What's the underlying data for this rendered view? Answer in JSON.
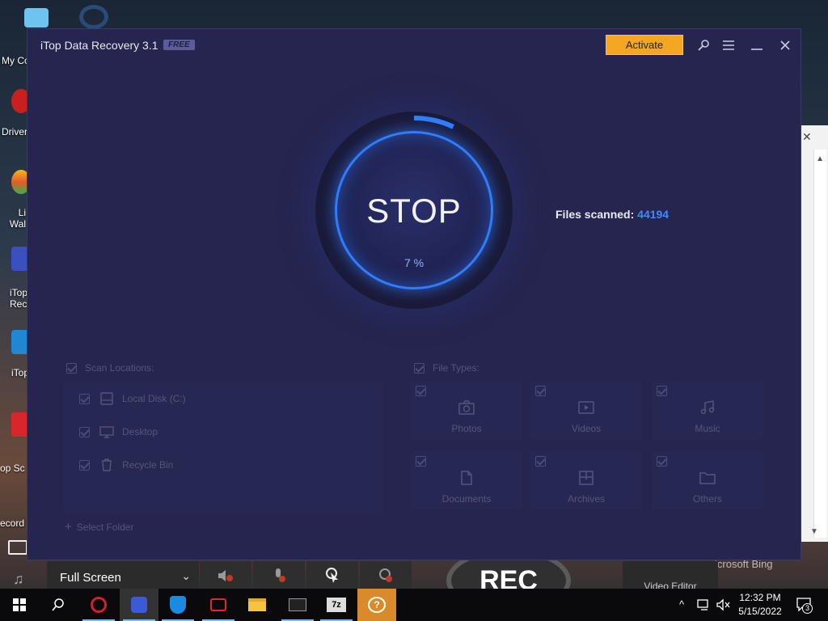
{
  "desktop": {
    "icons": [
      {
        "label": "My Co"
      },
      {
        "label": "Driver"
      },
      {
        "label": "Li\nWal"
      },
      {
        "label": "iTop\nRecord"
      },
      {
        "label": "iTop"
      },
      {
        "label": "op Sc"
      }
    ],
    "right_window_title": "icrosoft Bing"
  },
  "recorder": {
    "left_label": "ecord",
    "mode_label": "Full Screen",
    "rec_label": "REC",
    "video_editor_label": "Video Editor"
  },
  "app": {
    "title": "iTop Data Recovery 3.1",
    "badge": "FREE",
    "activate_label": "Activate",
    "scan": {
      "button_label": "STOP",
      "progress_text": "7 %",
      "progress": 0.07,
      "files_scanned_label": "Files scanned:",
      "files_scanned_count": "44194"
    },
    "locations": {
      "header": "Scan Locations:",
      "items": [
        {
          "label": "Local Disk (C:)"
        },
        {
          "label": "Desktop"
        },
        {
          "label": "Recycle Bin"
        }
      ],
      "select_folder": "Select Folder"
    },
    "file_types": {
      "header": "File Types:",
      "items": [
        {
          "label": "Photos"
        },
        {
          "label": "Videos"
        },
        {
          "label": "Music"
        },
        {
          "label": "Documents"
        },
        {
          "label": "Archives"
        },
        {
          "label": "Others"
        }
      ]
    }
  },
  "taskbar": {
    "time": "12:32 PM",
    "date": "5/15/2022",
    "notification_count": "3"
  },
  "colors": {
    "accent": "#2f7dff",
    "activate": "#f5a623",
    "window_bg": "#25254f"
  }
}
